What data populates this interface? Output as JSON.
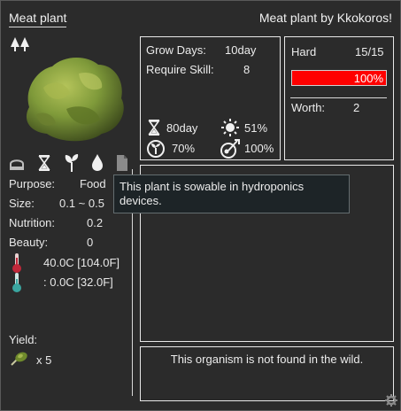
{
  "header": {
    "title": "Meat plant",
    "credit": "Meat plant by Kkokoros!"
  },
  "left": {
    "icons": [
      "tree-icon",
      "hood-icon",
      "hourglass-icon",
      "sprout-icon",
      "water-drop-icon",
      "document-icon"
    ],
    "purpose_label": "Purpose:",
    "purpose_value": "Food",
    "size_label": "Size:",
    "size_value": "0.1 ~ 0.5",
    "nutrition_label": "Nutrition:",
    "nutrition_value": "0.2",
    "beauty_label": "Beauty:",
    "beauty_value": "0",
    "temp_max": "40.0C [104.0F]",
    "temp_min": ": 0.0C [32.0F]",
    "yield_label": "Yield:",
    "yield_value": "x 5"
  },
  "growth": {
    "grow_days_label": "Grow Days:",
    "grow_days_value": "10day",
    "require_skill_label": "Require Skill:",
    "require_skill_value": "8",
    "time_value": "80day",
    "light_value": "51%",
    "fertility_value": "70%",
    "yield_mult_value": "100%"
  },
  "status": {
    "hard_label": "Hard",
    "hard_value": "15/15",
    "hp_percent": "100%",
    "hp_fraction": 1.0,
    "worth_label": "Worth:",
    "worth_value": "2"
  },
  "wild_note": "This organism is not found in the wild.",
  "tooltip": "This plant is sowable in hydroponics devices.",
  "colors": {
    "bar": "#ff0000",
    "background": "#2b2b2b",
    "border": "#e8e8e8"
  }
}
